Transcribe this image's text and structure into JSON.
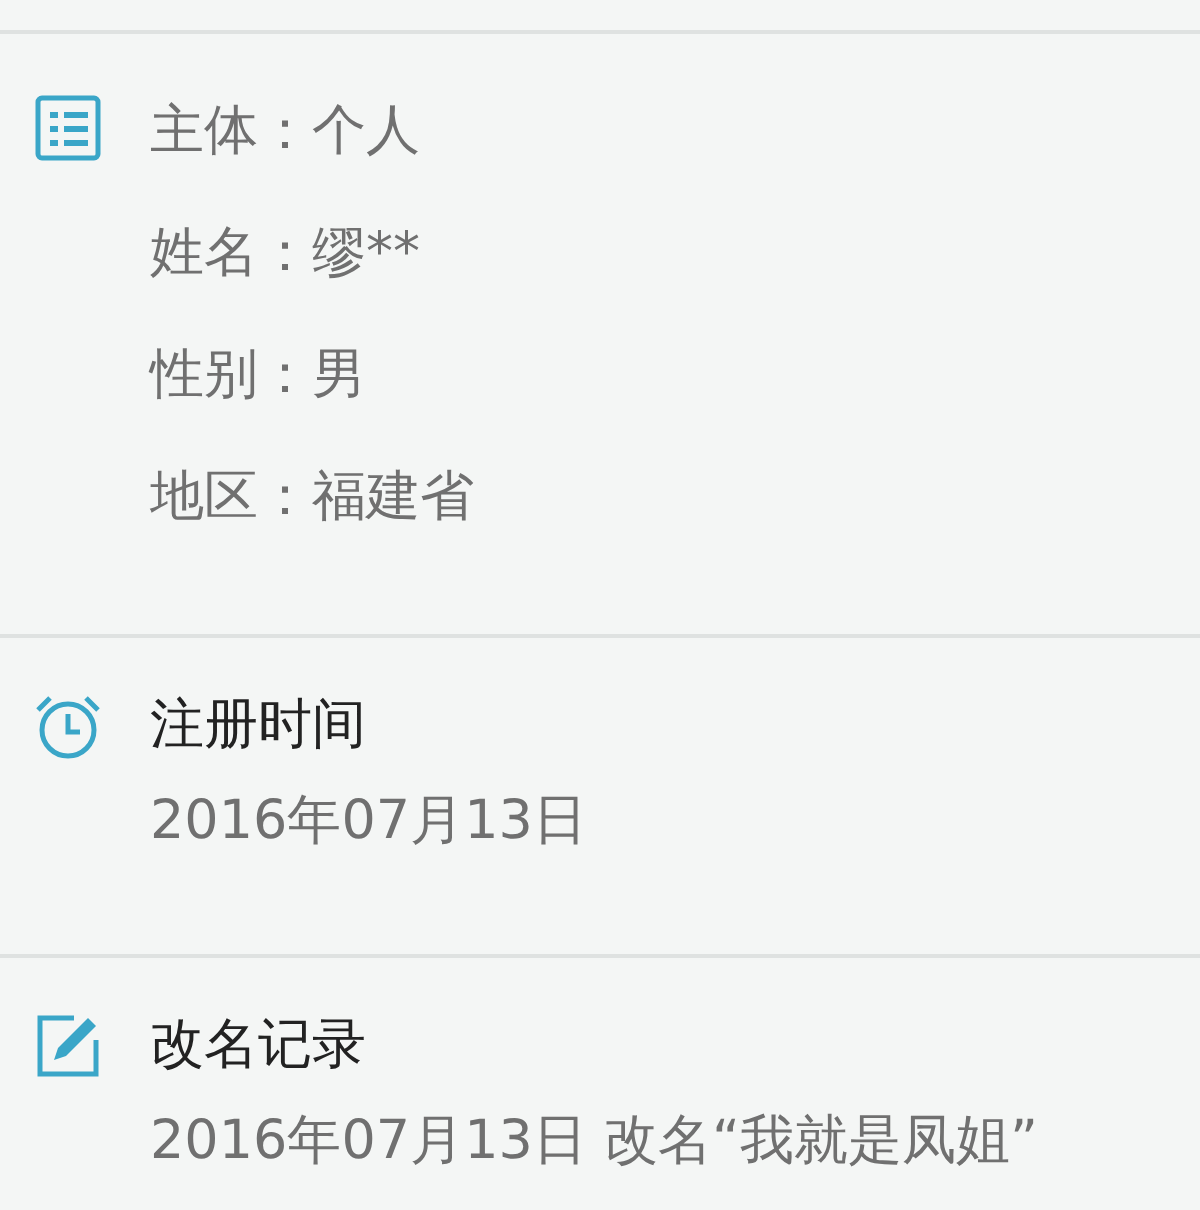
{
  "sections": [
    {
      "kind": "list",
      "lines": [
        "主体：个人",
        "姓名：缪**",
        "性别：男",
        "地区：福建省"
      ]
    },
    {
      "kind": "clock",
      "title": "注册时间",
      "lines": [
        "2016年07月13日"
      ]
    },
    {
      "kind": "edit",
      "title": "改名记录",
      "lines": [
        "2016年07月13日 改名“我就是凤姐”"
      ]
    }
  ]
}
